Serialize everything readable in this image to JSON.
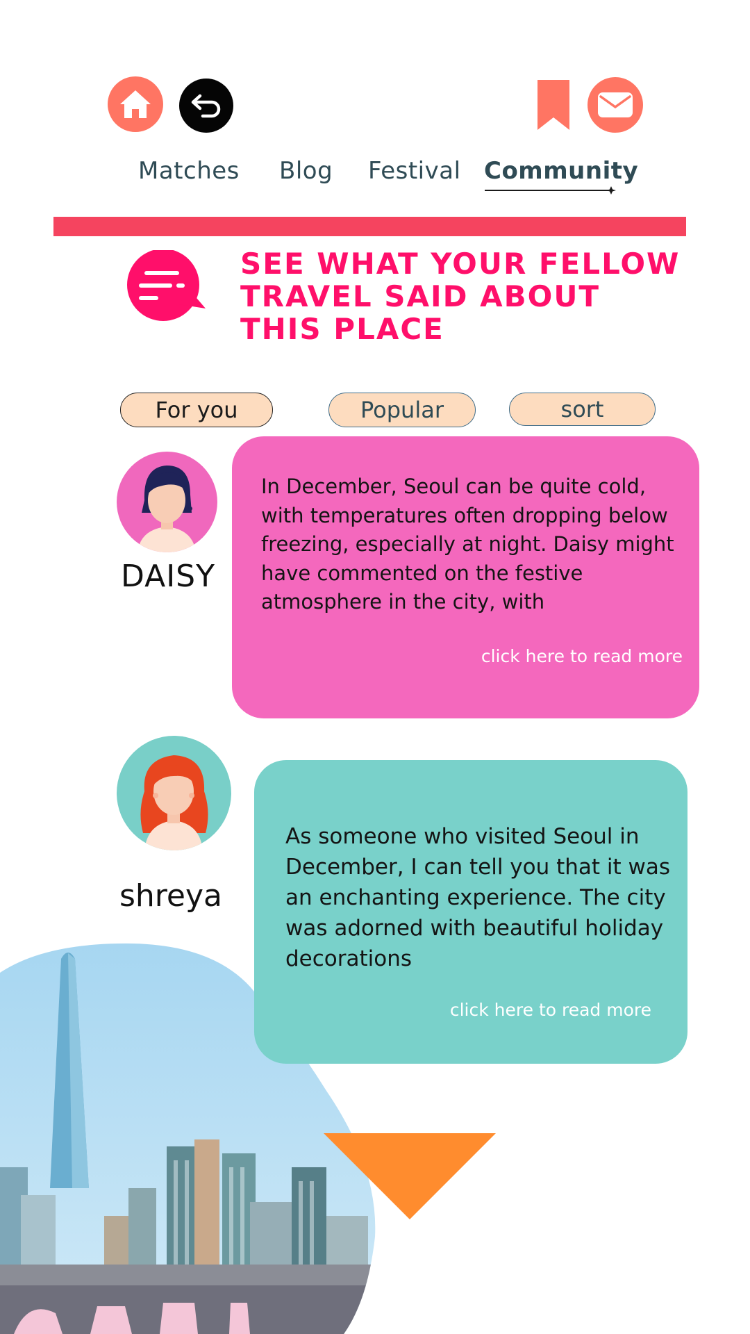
{
  "header": {
    "icons": [
      "home-icon",
      "back-arrow-icon",
      "bookmark-icon",
      "mail-icon"
    ],
    "colors": {
      "icon_coral": "#ff7563",
      "icon_black": "#050505"
    }
  },
  "tabs": [
    {
      "label": "Matches"
    },
    {
      "label": "Blog"
    },
    {
      "label": "Festival"
    },
    {
      "label": "Community",
      "active": true
    }
  ],
  "divider_color": "#f5445f",
  "heading": {
    "line1": "SEE WHAT YOUR FELLOW",
    "line2": "TRAVEL SAID ABOUT",
    "line3": "THIS PLACE",
    "color": "#ff0f6a",
    "icon": "chat-bubble-icon"
  },
  "filters": [
    {
      "label": "For you"
    },
    {
      "label": "Popular"
    },
    {
      "label": "sort"
    }
  ],
  "comments": [
    {
      "user": "DAISY",
      "avatar": "woman-dark-hair-avatar",
      "text": "In December, Seoul can be quite cold, with temperatures often dropping below freezing, especially at night. Daisy might have commented on the festive atmosphere in the city, with",
      "read_more": "click here to read more",
      "color": "#f468bd"
    },
    {
      "user": "shreya",
      "avatar": "woman-red-hair-avatar",
      "text": "As someone who visited Seoul in December, I can tell you that it was an enchanting experience. The city was adorned with beautiful holiday decorations",
      "read_more": "click here to read more",
      "color": "#79d1ca"
    }
  ],
  "footer": {
    "photo": "seoul-city-skyline-image",
    "arrow": "scroll-down-triangle-icon",
    "arrow_color": "#ff8c2e"
  }
}
